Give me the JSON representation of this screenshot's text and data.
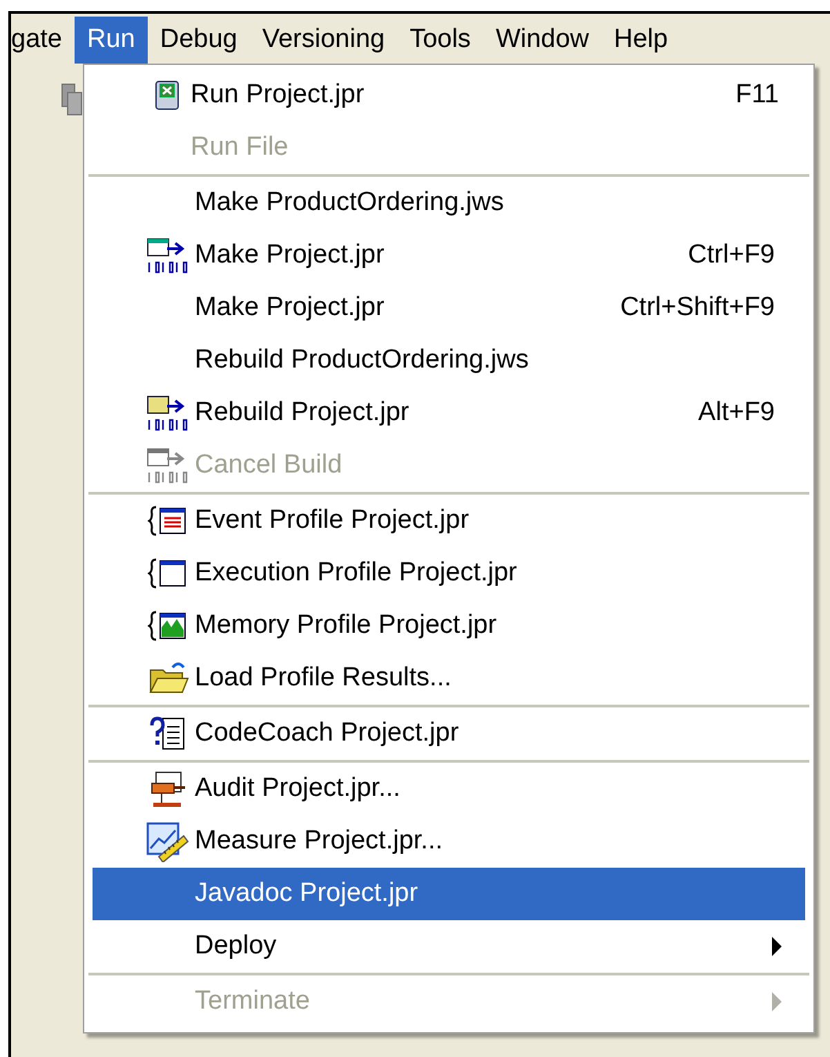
{
  "menubar": [
    {
      "label": "gate",
      "selected": false
    },
    {
      "label": "Run",
      "selected": true
    },
    {
      "label": "Debug",
      "selected": false
    },
    {
      "label": "Versioning",
      "selected": false
    },
    {
      "label": "Tools",
      "selected": false
    },
    {
      "label": "Window",
      "selected": false
    },
    {
      "label": "Help",
      "selected": false
    }
  ],
  "menu": {
    "sections": [
      {
        "items": [
          {
            "label": "Run Project.jpr",
            "shortcut": "F11",
            "disabled": false,
            "selected": false,
            "kind": "item"
          },
          {
            "label": "Run File",
            "disabled": true,
            "selected": false,
            "kind": "item"
          }
        ]
      },
      {
        "items": [
          {
            "label": "Make ProductOrdering.jws",
            "disabled": false,
            "selected": false,
            "kind": "item"
          },
          {
            "label": "Make Project.jpr",
            "shortcut": "Ctrl+F9",
            "disabled": false,
            "selected": false,
            "kind": "item"
          },
          {
            "label": "Make Project.jpr",
            "shortcut": "Ctrl+Shift+F9",
            "disabled": false,
            "selected": false,
            "kind": "item"
          },
          {
            "label": "Rebuild ProductOrdering.jws",
            "disabled": false,
            "selected": false,
            "kind": "item"
          },
          {
            "label": "Rebuild Project.jpr",
            "shortcut": "Alt+F9",
            "disabled": false,
            "selected": false,
            "kind": "item"
          },
          {
            "label": "Cancel Build",
            "disabled": true,
            "selected": false,
            "kind": "item"
          }
        ]
      },
      {
        "items": [
          {
            "label": "Event Profile Project.jpr",
            "disabled": false,
            "selected": false,
            "kind": "item"
          },
          {
            "label": "Execution Profile Project.jpr",
            "disabled": false,
            "selected": false,
            "kind": "item"
          },
          {
            "label": "Memory Profile Project.jpr",
            "disabled": false,
            "selected": false,
            "kind": "item"
          },
          {
            "label": "Load Profile Results...",
            "disabled": false,
            "selected": false,
            "kind": "item"
          }
        ]
      },
      {
        "items": [
          {
            "label": "CodeCoach Project.jpr",
            "disabled": false,
            "selected": false,
            "kind": "item"
          }
        ]
      },
      {
        "items": [
          {
            "label": "Audit Project.jpr...",
            "disabled": false,
            "selected": false,
            "kind": "item"
          },
          {
            "label": "Measure Project.jpr...",
            "disabled": false,
            "selected": false,
            "kind": "item"
          },
          {
            "label": "Javadoc Project.jpr",
            "disabled": false,
            "selected": true,
            "kind": "item"
          },
          {
            "label": "Deploy",
            "disabled": false,
            "selected": false,
            "kind": "submenu"
          }
        ]
      },
      {
        "items": [
          {
            "label": "Terminate",
            "disabled": true,
            "selected": false,
            "kind": "submenu"
          }
        ]
      }
    ]
  }
}
